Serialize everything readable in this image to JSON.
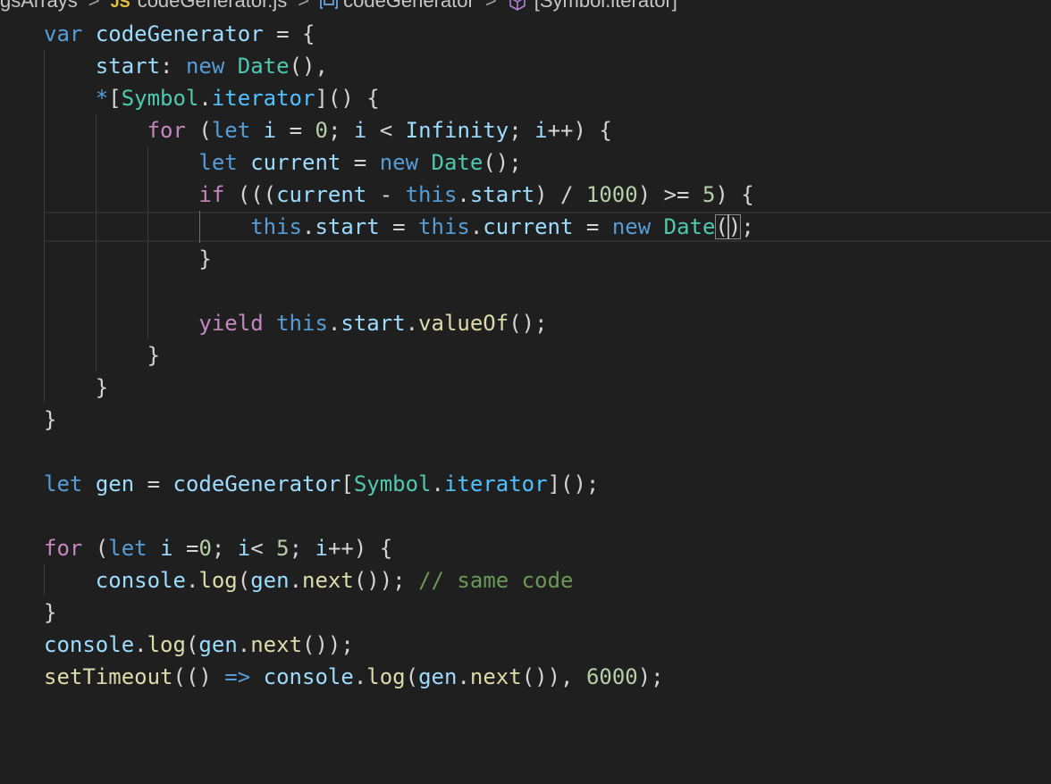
{
  "breadcrumb": {
    "segments": [
      "gsArrays",
      "codeGenerator.js",
      "codeGenerator",
      "[Symbol.iterator]"
    ],
    "file_badge": "JS",
    "separator": ">"
  },
  "code": {
    "lines": [
      [
        [
          "kw",
          "var"
        ],
        [
          "p",
          " "
        ],
        [
          "v",
          "codeGenerator"
        ],
        [
          "p",
          " = {"
        ]
      ],
      [
        [
          "p",
          "    "
        ],
        [
          "v",
          "start"
        ],
        [
          "p",
          ": "
        ],
        [
          "kw",
          "new"
        ],
        [
          "p",
          " "
        ],
        [
          "cls",
          "Date"
        ],
        [
          "p",
          "(),"
        ]
      ],
      [
        [
          "p",
          "    "
        ],
        [
          "kw",
          "*"
        ],
        [
          "p",
          "["
        ],
        [
          "cls",
          "Symbol"
        ],
        [
          "p",
          "."
        ],
        [
          "obj",
          "iterator"
        ],
        [
          "p",
          "]() {"
        ]
      ],
      [
        [
          "p",
          "        "
        ],
        [
          "ctl",
          "for"
        ],
        [
          "p",
          " ("
        ],
        [
          "kw",
          "let"
        ],
        [
          "p",
          " "
        ],
        [
          "v",
          "i"
        ],
        [
          "p",
          " = "
        ],
        [
          "num",
          "0"
        ],
        [
          "p",
          "; "
        ],
        [
          "v",
          "i"
        ],
        [
          "p",
          " < "
        ],
        [
          "v",
          "Infinity"
        ],
        [
          "p",
          "; "
        ],
        [
          "v",
          "i"
        ],
        [
          "p",
          "++) {"
        ]
      ],
      [
        [
          "p",
          "            "
        ],
        [
          "kw",
          "let"
        ],
        [
          "p",
          " "
        ],
        [
          "v",
          "current"
        ],
        [
          "p",
          " = "
        ],
        [
          "kw",
          "new"
        ],
        [
          "p",
          " "
        ],
        [
          "cls",
          "Date"
        ],
        [
          "p",
          "();"
        ]
      ],
      [
        [
          "p",
          "            "
        ],
        [
          "ctl",
          "if"
        ],
        [
          "p",
          " ((("
        ],
        [
          "v",
          "current"
        ],
        [
          "p",
          " - "
        ],
        [
          "kw",
          "this"
        ],
        [
          "p",
          "."
        ],
        [
          "v",
          "start"
        ],
        [
          "p",
          ") / "
        ],
        [
          "num",
          "1000"
        ],
        [
          "p",
          ") >= "
        ],
        [
          "num",
          "5"
        ],
        [
          "p",
          ") {"
        ]
      ],
      [
        [
          "p",
          "                "
        ],
        [
          "kw",
          "this"
        ],
        [
          "p",
          "."
        ],
        [
          "v",
          "start"
        ],
        [
          "p",
          " = "
        ],
        [
          "kw",
          "this"
        ],
        [
          "p",
          "."
        ],
        [
          "v",
          "current"
        ],
        [
          "p",
          " = "
        ],
        [
          "kw",
          "new"
        ],
        [
          "p",
          " "
        ],
        [
          "cls",
          "Date"
        ],
        [
          "p",
          "("
        ],
        [
          "p",
          ")"
        ],
        [
          "p",
          ";"
        ]
      ],
      [
        [
          "p",
          "            }"
        ]
      ],
      [],
      [
        [
          "p",
          "            "
        ],
        [
          "ctl",
          "yield"
        ],
        [
          "p",
          " "
        ],
        [
          "kw",
          "this"
        ],
        [
          "p",
          "."
        ],
        [
          "v",
          "start"
        ],
        [
          "p",
          "."
        ],
        [
          "fn",
          "valueOf"
        ],
        [
          "p",
          "();"
        ]
      ],
      [
        [
          "p",
          "        }"
        ]
      ],
      [
        [
          "p",
          "    }"
        ]
      ],
      [
        [
          "p",
          "}"
        ]
      ],
      [],
      [
        [
          "kw",
          "let"
        ],
        [
          "p",
          " "
        ],
        [
          "v",
          "gen"
        ],
        [
          "p",
          " = "
        ],
        [
          "v",
          "codeGenerator"
        ],
        [
          "p",
          "["
        ],
        [
          "cls",
          "Symbol"
        ],
        [
          "p",
          "."
        ],
        [
          "obj",
          "iterator"
        ],
        [
          "p",
          "]();"
        ]
      ],
      [],
      [
        [
          "ctl",
          "for"
        ],
        [
          "p",
          " ("
        ],
        [
          "kw",
          "let"
        ],
        [
          "p",
          " "
        ],
        [
          "v",
          "i"
        ],
        [
          "p",
          " ="
        ],
        [
          "num",
          "0"
        ],
        [
          "p",
          "; "
        ],
        [
          "v",
          "i"
        ],
        [
          "p",
          "< "
        ],
        [
          "num",
          "5"
        ],
        [
          "p",
          "; "
        ],
        [
          "v",
          "i"
        ],
        [
          "p",
          "++) {"
        ]
      ],
      [
        [
          "p",
          "    "
        ],
        [
          "v",
          "console"
        ],
        [
          "p",
          "."
        ],
        [
          "fn",
          "log"
        ],
        [
          "p",
          "("
        ],
        [
          "v",
          "gen"
        ],
        [
          "p",
          "."
        ],
        [
          "fn",
          "next"
        ],
        [
          "p",
          "()); "
        ],
        [
          "cmt",
          "// same code"
        ]
      ],
      [
        [
          "p",
          "}"
        ]
      ],
      [
        [
          "v",
          "console"
        ],
        [
          "p",
          "."
        ],
        [
          "fn",
          "log"
        ],
        [
          "p",
          "("
        ],
        [
          "v",
          "gen"
        ],
        [
          "p",
          "."
        ],
        [
          "fn",
          "next"
        ],
        [
          "p",
          "());"
        ]
      ],
      [
        [
          "fn",
          "setTimeout"
        ],
        [
          "p",
          "(() "
        ],
        [
          "kw",
          "=>"
        ],
        [
          "p",
          " "
        ],
        [
          "v",
          "console"
        ],
        [
          "p",
          "."
        ],
        [
          "fn",
          "log"
        ],
        [
          "p",
          "("
        ],
        [
          "v",
          "gen"
        ],
        [
          "p",
          "."
        ],
        [
          "fn",
          "next"
        ],
        [
          "p",
          "()), "
        ],
        [
          "num",
          "6000"
        ],
        [
          "p",
          ");"
        ]
      ]
    ],
    "current_line_index": 6
  }
}
